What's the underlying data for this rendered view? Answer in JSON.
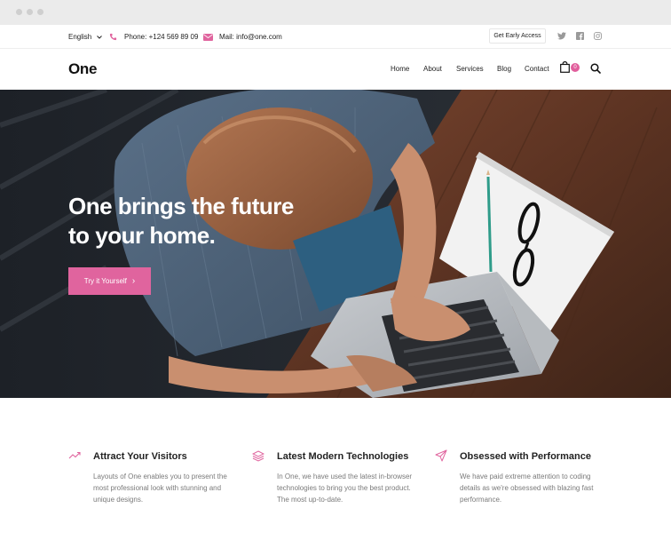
{
  "topbar": {
    "language": "English",
    "phone": "Phone: +124 569 89 09",
    "mail": "Mail: info@one.com",
    "early_access": "Get Early Access"
  },
  "navbar": {
    "logo": "One",
    "links": [
      "Home",
      "About",
      "Services",
      "Blog",
      "Contact"
    ],
    "cart_count": "0"
  },
  "hero": {
    "title_line1": "One brings the future",
    "title_line2": "to your home.",
    "button_label": "Try it Yourself",
    "button_chevron": "›"
  },
  "features": [
    {
      "icon": "trending-up-icon",
      "title": "Attract Your Visitors",
      "text": "Layouts of One enables you to present the most professional look with stunning and unique designs."
    },
    {
      "icon": "layers-icon",
      "title": "Latest Modern Technologies",
      "text": "In One, we have used the latest in-browser technologies to bring you the best product. The most up-to-date."
    },
    {
      "icon": "paper-plane-icon",
      "title": "Obsessed with Performance",
      "text": "We have paid extreme attention to coding details as we're obsessed with blazing fast performance."
    }
  ],
  "colors": {
    "accent": "#e0649e",
    "text_dark": "#222222",
    "text_muted": "#7a7a7a"
  }
}
